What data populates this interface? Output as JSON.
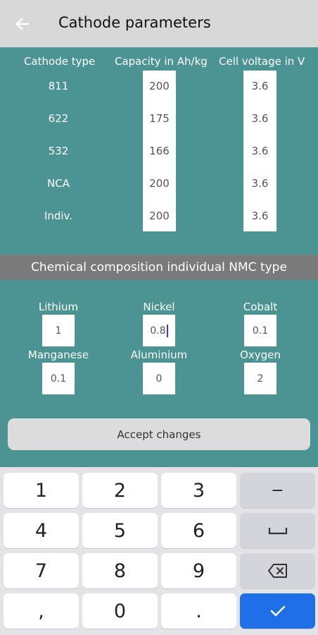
{
  "appbar": {
    "title": "Cathode parameters",
    "back_icon": "arrow-left-icon"
  },
  "params_table": {
    "headers": [
      "Cathode type",
      "Capacity in Ah/kg",
      "Cell voltage in V"
    ],
    "rows": [
      {
        "type": "811",
        "capacity": "200",
        "voltage": "3.6"
      },
      {
        "type": "622",
        "capacity": "175",
        "voltage": "3.6"
      },
      {
        "type": "532",
        "capacity": "166",
        "voltage": "3.6"
      },
      {
        "type": "NCA",
        "capacity": "200",
        "voltage": "3.6"
      },
      {
        "type": "Indiv.",
        "capacity": "200",
        "voltage": "3.6"
      }
    ]
  },
  "composition": {
    "section_title": "Chemical composition individual NMC type",
    "elements": [
      {
        "label": "Lithium",
        "value": "1"
      },
      {
        "label": "Nickel",
        "value": "0.8"
      },
      {
        "label": "Cobalt",
        "value": "0.1"
      },
      {
        "label": "Manganese",
        "value": "0.1"
      },
      {
        "label": "Aluminium",
        "value": "0"
      },
      {
        "label": "Oxygen",
        "value": "2"
      }
    ]
  },
  "accept_button": {
    "label": "Accept changes"
  },
  "keyboard": {
    "rows": [
      [
        "1",
        "2",
        "3",
        "−"
      ],
      [
        "4",
        "5",
        "6",
        "␣"
      ],
      [
        "7",
        "8",
        "9",
        "⌫"
      ],
      [
        ",",
        "0",
        ".",
        "✓"
      ]
    ]
  },
  "colors": {
    "accent": "#4c9494",
    "enter": "#1f6fe8"
  }
}
